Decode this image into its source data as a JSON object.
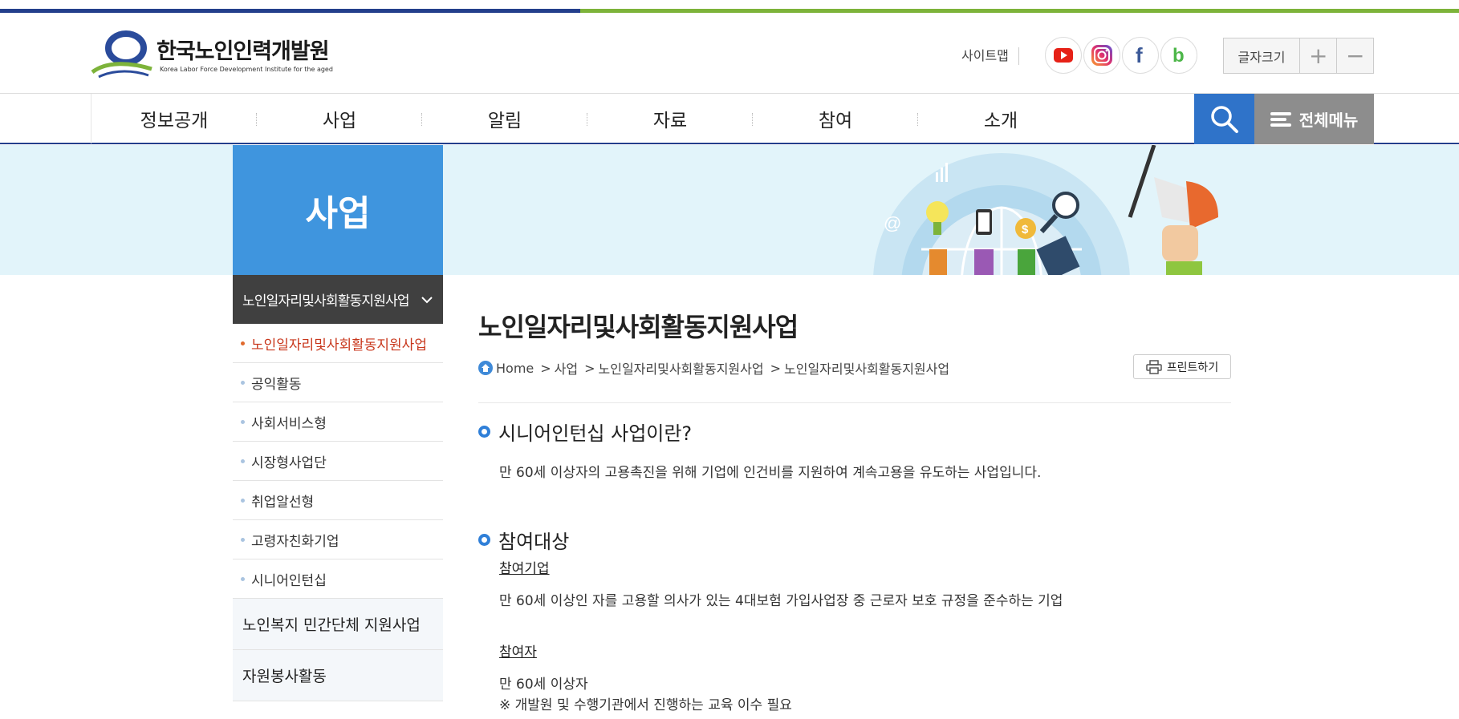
{
  "header": {
    "logo_text": "한국노인인력개발원",
    "logo_sub": "Korea Labor Force Development Institute for the aged",
    "sitemap_label": "사이트맵",
    "social": [
      {
        "name": "youtube-icon"
      },
      {
        "name": "instagram-icon"
      },
      {
        "name": "facebook-icon"
      },
      {
        "name": "blog-icon"
      }
    ],
    "fontsize_label": "글자크기",
    "fontsize_plus": "+",
    "fontsize_minus": "−"
  },
  "gnb": {
    "items": [
      {
        "label": "정보공개"
      },
      {
        "label": "사업"
      },
      {
        "label": "알림"
      },
      {
        "label": "자료"
      },
      {
        "label": "참여"
      },
      {
        "label": "소개"
      }
    ],
    "allmenu_label": "전체메뉴"
  },
  "side": {
    "title": "사업",
    "open_menu": "노인일자리및사회활동지원사업",
    "sub_items": [
      {
        "label": "노인일자리및사회활동지원사업",
        "active": true
      },
      {
        "label": "공익활동"
      },
      {
        "label": "사회서비스형"
      },
      {
        "label": "시장형사업단"
      },
      {
        "label": "취업알선형"
      },
      {
        "label": "고령자친화기업"
      },
      {
        "label": "시니어인턴십"
      }
    ],
    "other_menus": [
      "노인복지 민간단체 지원사업",
      "자원봉사활동"
    ]
  },
  "content": {
    "page_title": "노인일자리및사회활동지원사업",
    "breadcrumb": [
      "Home",
      "사업",
      "노인일자리및사회활동지원사업",
      "노인일자리및사회활동지원사업"
    ],
    "print_label": "프린트하기",
    "section1_title": "시니어인턴십 사업이란?",
    "section1_text": "만 60세 이상자의 고용촉진을 위해 기업에 인건비를 지원하여 계속고용을 유도하는 사업입니다.",
    "section2_title": "참여대상",
    "company_heading": "참여기업",
    "company_text": "만 60세 이상인 자를 고용할 의사가 있는 4대보험 가입사업장 중 근로자 보호 규정을 준수하는 기업",
    "participant_heading": "참여자",
    "participant_text": "만 60세 이상자",
    "participant_note": "※ 개발원 및 수행기관에서 진행하는 교육 이수 필요"
  },
  "colors": {
    "brand_blue": "#233f8c",
    "brand_green": "#7db33a",
    "side_blue": "#3f95de",
    "active_red": "#c8361b"
  }
}
